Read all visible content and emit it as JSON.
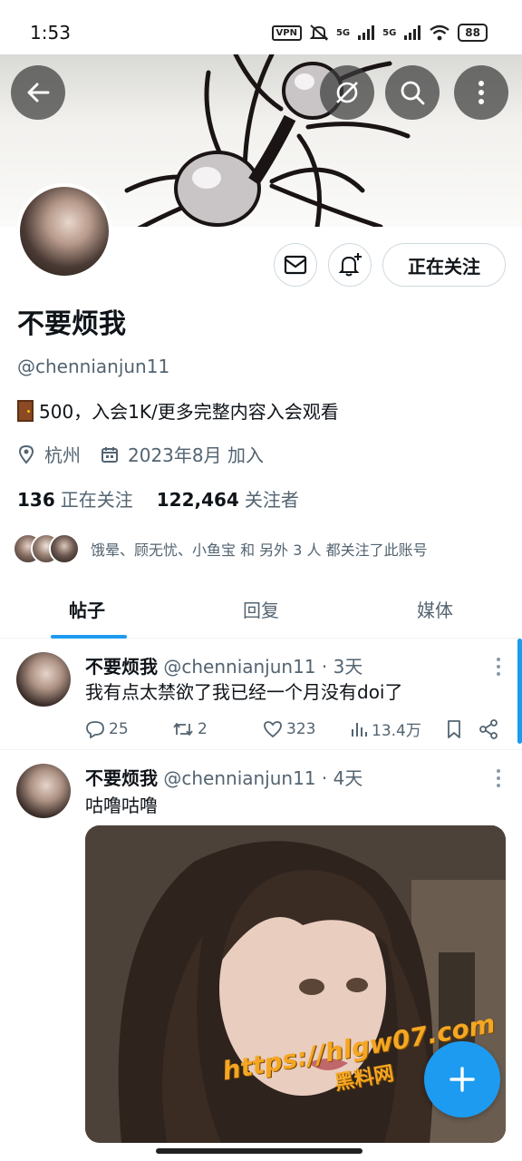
{
  "status_bar": {
    "time": "1:53",
    "vpn": "VPN",
    "net1": "5G",
    "net2": "5G",
    "battery": "88"
  },
  "profile": {
    "display_name": "不要烦我",
    "handle": "@chennianjun11",
    "bio": "500，入会1K/更多完整内容入会观看",
    "location": "杭州",
    "joined": "2023年8月 加入",
    "following_count": "136",
    "following_label": "正在关注",
    "followers_count": "122,464",
    "followers_label": "关注者",
    "followed_by": "饿晕、顾无忧、小鱼宝 和 另外 3 人 都关注了此账号",
    "follow_button": "正在关注"
  },
  "tabs": [
    {
      "label": "帖子",
      "active": true
    },
    {
      "label": "回复",
      "active": false
    },
    {
      "label": "媒体",
      "active": false
    }
  ],
  "posts": [
    {
      "name": "不要烦我",
      "meta": "@chennianjun11 · 3天",
      "text": "我有点太禁欲了我已经一个月没有doi了",
      "replies": "25",
      "reposts": "2",
      "likes": "323",
      "views": "13.4万"
    },
    {
      "name": "不要烦我",
      "meta": "@chennianjun11 · 4天",
      "text": "咕噜咕噜"
    }
  ],
  "watermark": {
    "line1": "https://hlgw07.com",
    "line2": "黑料网"
  },
  "icons": {
    "back": "arrow-left-icon",
    "hide": "slash-circle-icon",
    "search": "search-icon",
    "more": "more-vertical-icon",
    "message": "envelope-icon",
    "notify": "bell-plus-icon",
    "location": "location-pin-icon",
    "calendar": "calendar-icon",
    "reply": "comment-icon",
    "repost": "repost-icon",
    "like": "heart-icon",
    "views": "bar-chart-icon",
    "bookmark": "bookmark-icon",
    "share": "share-icon",
    "compose": "plus-icon"
  },
  "colors": {
    "accent": "#1d9bf0",
    "text": "#0f1419",
    "secondary": "#536471"
  }
}
